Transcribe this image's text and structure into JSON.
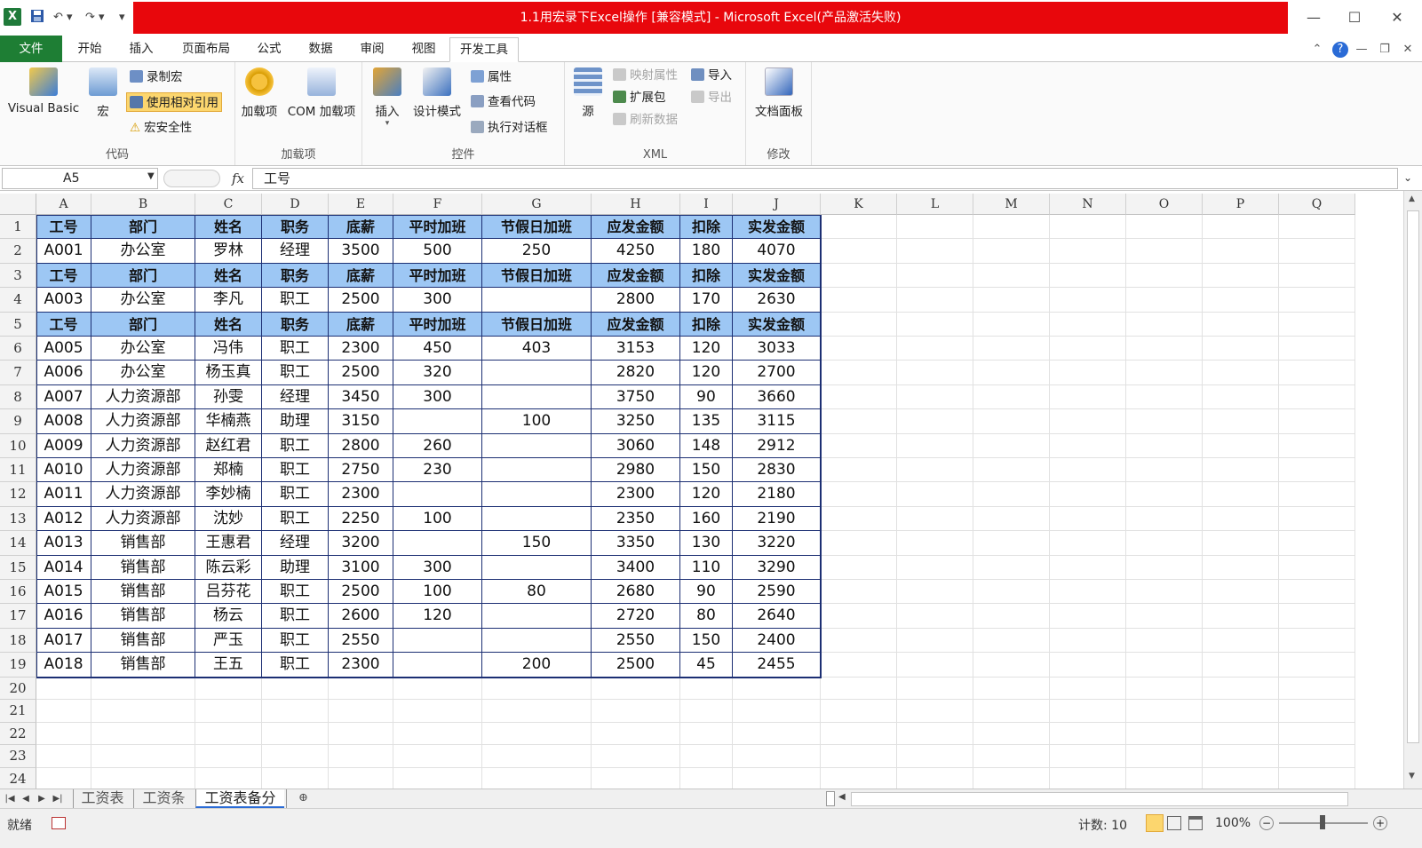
{
  "window": {
    "title": "1.1用宏录下Excel操作  [兼容模式] - Microsoft Excel(产品激活失败)",
    "app_icon": "X"
  },
  "quick_access": {
    "save_icon": "save-icon",
    "undo_icon": "undo-icon",
    "redo_icon": "redo-icon",
    "customize_icon": "customize-icon"
  },
  "window_controls": {
    "minimize": "—",
    "maximize": "☐",
    "close": "✕"
  },
  "tabs": [
    {
      "label": "文件"
    },
    {
      "label": "开始"
    },
    {
      "label": "插入"
    },
    {
      "label": "页面布局"
    },
    {
      "label": "公式"
    },
    {
      "label": "数据"
    },
    {
      "label": "审阅"
    },
    {
      "label": "视图"
    },
    {
      "label": "开发工具"
    }
  ],
  "ribbon": {
    "code": {
      "label": "代码",
      "visual_basic": "Visual Basic",
      "macros": "宏",
      "record_macro": "录制宏",
      "use_relative": "使用相对引用",
      "macro_security": "宏安全性"
    },
    "addins": {
      "label": "加载项",
      "addins_btn": "加载项",
      "com_addins": "COM 加载项"
    },
    "controls": {
      "label": "控件",
      "insert": "插入",
      "design_mode": "设计模式",
      "properties": "属性",
      "view_code": "查看代码",
      "run_dialog": "执行对话框"
    },
    "xml": {
      "label": "XML",
      "source": "源",
      "map_properties": "映射属性",
      "expansion_packs": "扩展包",
      "refresh_data": "刷新数据",
      "import": "导入",
      "export": "导出"
    },
    "modify": {
      "label": "修改",
      "doc_panel": "文档面板"
    }
  },
  "formula_bar": {
    "name_box": "A5",
    "fx": "fx",
    "formula": "工号"
  },
  "columns": [
    "A",
    "B",
    "C",
    "D",
    "E",
    "F",
    "G",
    "H",
    "I",
    "J",
    "K",
    "L",
    "M",
    "N",
    "O",
    "P",
    "Q"
  ],
  "row_numbers": [
    "1",
    "2",
    "3",
    "4",
    "5",
    "6",
    "7",
    "8",
    "9",
    "10",
    "11",
    "12",
    "13",
    "14",
    "15",
    "16",
    "17",
    "18",
    "19",
    "20",
    "21",
    "22",
    "23",
    "24"
  ],
  "rows": [
    [
      "工号",
      "部门",
      "姓名",
      "职务",
      "底薪",
      "平时加班",
      "节假日加班",
      "应发金额",
      "扣除",
      "实发金额"
    ],
    [
      "A001",
      "办公室",
      "罗林",
      "经理",
      "3500",
      "500",
      "250",
      "4250",
      "180",
      "4070"
    ],
    [
      "工号",
      "部门",
      "姓名",
      "职务",
      "底薪",
      "平时加班",
      "节假日加班",
      "应发金额",
      "扣除",
      "实发金额"
    ],
    [
      "A003",
      "办公室",
      "李凡",
      "职工",
      "2500",
      "300",
      "",
      "2800",
      "170",
      "2630"
    ],
    [
      "工号",
      "部门",
      "姓名",
      "职务",
      "底薪",
      "平时加班",
      "节假日加班",
      "应发金额",
      "扣除",
      "实发金额"
    ],
    [
      "A005",
      "办公室",
      "冯伟",
      "职工",
      "2300",
      "450",
      "403",
      "3153",
      "120",
      "3033"
    ],
    [
      "A006",
      "办公室",
      "杨玉真",
      "职工",
      "2500",
      "320",
      "",
      "2820",
      "120",
      "2700"
    ],
    [
      "A007",
      "人力资源部",
      "孙雯",
      "经理",
      "3450",
      "300",
      "",
      "3750",
      "90",
      "3660"
    ],
    [
      "A008",
      "人力资源部",
      "华楠燕",
      "助理",
      "3150",
      "",
      "100",
      "3250",
      "135",
      "3115"
    ],
    [
      "A009",
      "人力资源部",
      "赵红君",
      "职工",
      "2800",
      "260",
      "",
      "3060",
      "148",
      "2912"
    ],
    [
      "A010",
      "人力资源部",
      "郑楠",
      "职工",
      "2750",
      "230",
      "",
      "2980",
      "150",
      "2830"
    ],
    [
      "A011",
      "人力资源部",
      "李妙楠",
      "职工",
      "2300",
      "",
      "",
      "2300",
      "120",
      "2180"
    ],
    [
      "A012",
      "人力资源部",
      "沈妙",
      "职工",
      "2250",
      "100",
      "",
      "2350",
      "160",
      "2190"
    ],
    [
      "A013",
      "销售部",
      "王惠君",
      "经理",
      "3200",
      "",
      "150",
      "3350",
      "130",
      "3220"
    ],
    [
      "A014",
      "销售部",
      "陈云彩",
      "助理",
      "3100",
      "300",
      "",
      "3400",
      "110",
      "3290"
    ],
    [
      "A015",
      "销售部",
      "吕芬花",
      "职工",
      "2500",
      "100",
      "80",
      "2680",
      "90",
      "2590"
    ],
    [
      "A016",
      "销售部",
      "杨云",
      "职工",
      "2600",
      "120",
      "",
      "2720",
      "80",
      "2640"
    ],
    [
      "A017",
      "销售部",
      "严玉",
      "职工",
      "2550",
      "",
      "",
      "2550",
      "150",
      "2400"
    ],
    [
      "A018",
      "销售部",
      "王五",
      "职工",
      "2300",
      "",
      "200",
      "2500",
      "45",
      "2455"
    ]
  ],
  "header_row_indices": [
    0,
    2,
    4
  ],
  "colors": {
    "header_fill": "#9dc7f4",
    "table_border": "#1c2f73",
    "title_bar": "#e8070c",
    "file_tab": "#1e7e34"
  },
  "sheets": [
    {
      "label": "工资表"
    },
    {
      "label": "工资条"
    },
    {
      "label": "工资表备分"
    }
  ],
  "status": {
    "ready": "就绪",
    "count": "计数: 10",
    "zoom": "100%"
  }
}
